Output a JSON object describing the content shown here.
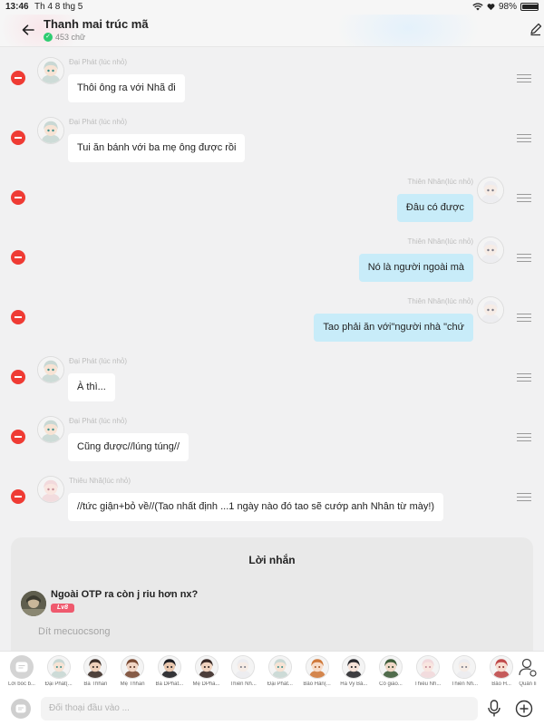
{
  "status_bar": {
    "time": "13:46",
    "date": "Th 4 8 thg 5",
    "battery": "98%",
    "battery_level": 0.98
  },
  "header": {
    "title": "Thanh mai trúc mã",
    "word_count": "453 chữ"
  },
  "messages": [
    {
      "side": "left",
      "sender": "Đại Phát (lúc nhỏ)",
      "text": "Thôi ông ra với Nhã đi",
      "avatar": "boy-teal-hair-avatar"
    },
    {
      "side": "left",
      "sender": "Đại Phát (lúc nhỏ)",
      "text": "Tui ăn bánh với ba mẹ ông được rồi",
      "avatar": "boy-teal-hair-avatar"
    },
    {
      "side": "right",
      "sender": "Thiên Nhân(lúc nhỏ)",
      "text": "Đâu có được",
      "avatar": "white-hair-avatar"
    },
    {
      "side": "right",
      "sender": "Thiên Nhân(lúc nhỏ)",
      "text": "Nó là người ngoài mà",
      "avatar": "white-hair-avatar"
    },
    {
      "side": "right",
      "sender": "Thiên Nhân(lúc nhỏ)",
      "text": "Tao phải ăn với\"người nhà \"chứ",
      "avatar": "white-hair-avatar"
    },
    {
      "side": "left",
      "sender": "Đại Phát (lúc nhỏ)",
      "text": "À thì...",
      "avatar": "boy-teal-hair-avatar"
    },
    {
      "side": "left",
      "sender": "Đại Phát (lúc nhỏ)",
      "text": "Cũng được//lúng túng//",
      "avatar": "boy-teal-hair-avatar"
    },
    {
      "side": "left",
      "sender": "Thiêu Nhã(lúc nhỏ)",
      "text": "//tức giận+bỏ về//(Tao nhất định ...1 ngày nào đó tao sẽ cướp anh Nhân từ mày!)",
      "avatar": "girl-pink-hair-avatar"
    }
  ],
  "comment_panel": {
    "title": "Lời nhắn",
    "comment": "Ngoài OTP ra còn j riu hơn nx?",
    "level_badge": "Lv8",
    "input_text": "Dít mecuocsong"
  },
  "characters": [
    {
      "label": "Lời bốc b...",
      "icon": "narration-icon"
    },
    {
      "label": "Đại Phát(...",
      "icon": "boy-teal-hair-avatar"
    },
    {
      "label": "Ba Thhan",
      "icon": "man-dark-hair-avatar"
    },
    {
      "label": "Mẹ Thhan",
      "icon": "woman-brown-hair-avatar"
    },
    {
      "label": "Ba DPhat...",
      "icon": "man-black-hair-avatar"
    },
    {
      "label": "Mẹ DPha...",
      "icon": "woman-dark-hair-avatar"
    },
    {
      "label": "Thiên Nh...",
      "icon": "white-hair-avatar"
    },
    {
      "label": "Đại Phát...",
      "icon": "boy-teal-hair-avatar"
    },
    {
      "label": "Bảo Hân(...",
      "icon": "girl-orange-hair-avatar"
    },
    {
      "label": "Hà Vy Bả...",
      "icon": "girl-black-hair-avatar"
    },
    {
      "label": "Cô giáo...",
      "icon": "woman-green-hair-avatar"
    },
    {
      "label": "Thiêu Nh...",
      "icon": "girl-pink-hair-avatar"
    },
    {
      "label": "Thiên Nh...",
      "icon": "white-hair-avatar"
    },
    {
      "label": "Bảo H...",
      "icon": "girl-red-hair-avatar"
    },
    {
      "label": "Quản lí",
      "icon": "manage-characters-icon"
    }
  ],
  "input_bar": {
    "placeholder": "Đối thoại đầu vào ..."
  },
  "colors": {
    "delete_red": "#ef3b34",
    "right_bubble": "#c8ecf9",
    "left_bubble": "#ffffff",
    "background": "#f1f1f2",
    "badge_pink": "#ef5a6e",
    "verified_green": "#2ecc71"
  }
}
